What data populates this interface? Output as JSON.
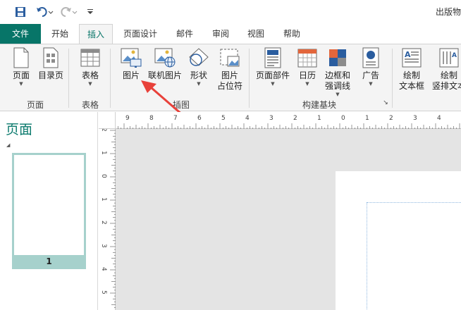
{
  "window": {
    "title": "出版物"
  },
  "tabs": [
    {
      "label": "文件"
    },
    {
      "label": "开始"
    },
    {
      "label": "插入"
    },
    {
      "label": "页面设计"
    },
    {
      "label": "邮件"
    },
    {
      "label": "审阅"
    },
    {
      "label": "视图"
    },
    {
      "label": "帮助"
    }
  ],
  "ribbon": {
    "buttons": [
      {
        "label": "页面",
        "sub": ""
      },
      {
        "label": "目录页",
        "sub": ""
      },
      {
        "label": "表格",
        "sub": ""
      },
      {
        "label": "图片",
        "sub": ""
      },
      {
        "label": "联机图片",
        "sub": ""
      },
      {
        "label": "形状",
        "sub": ""
      },
      {
        "label": "图片",
        "sub": "占位符"
      },
      {
        "label": "页面部件",
        "sub": ""
      },
      {
        "label": "日历",
        "sub": ""
      },
      {
        "label": "边框和",
        "sub": "强调线"
      },
      {
        "label": "广告",
        "sub": ""
      },
      {
        "label": "绘制",
        "sub": "文本框"
      },
      {
        "label": "绘制",
        "sub": "竖排文本"
      }
    ],
    "groups": [
      {
        "label": "页面"
      },
      {
        "label": "表格"
      },
      {
        "label": "插图"
      },
      {
        "label": "构建基块"
      }
    ]
  },
  "pages_pane": {
    "title": "页面",
    "thumb_number": "1"
  },
  "ruler": {
    "h_labels": [
      "9",
      "8",
      "7",
      "6",
      "5",
      "4",
      "3",
      "2",
      "1",
      "0",
      "1",
      "2",
      "3",
      "4"
    ],
    "v_labels": [
      "2",
      "1",
      "0",
      "1",
      "2",
      "3",
      "4",
      "5"
    ]
  },
  "colors": {
    "accent": "#077568",
    "arrow": "#e8413a"
  }
}
